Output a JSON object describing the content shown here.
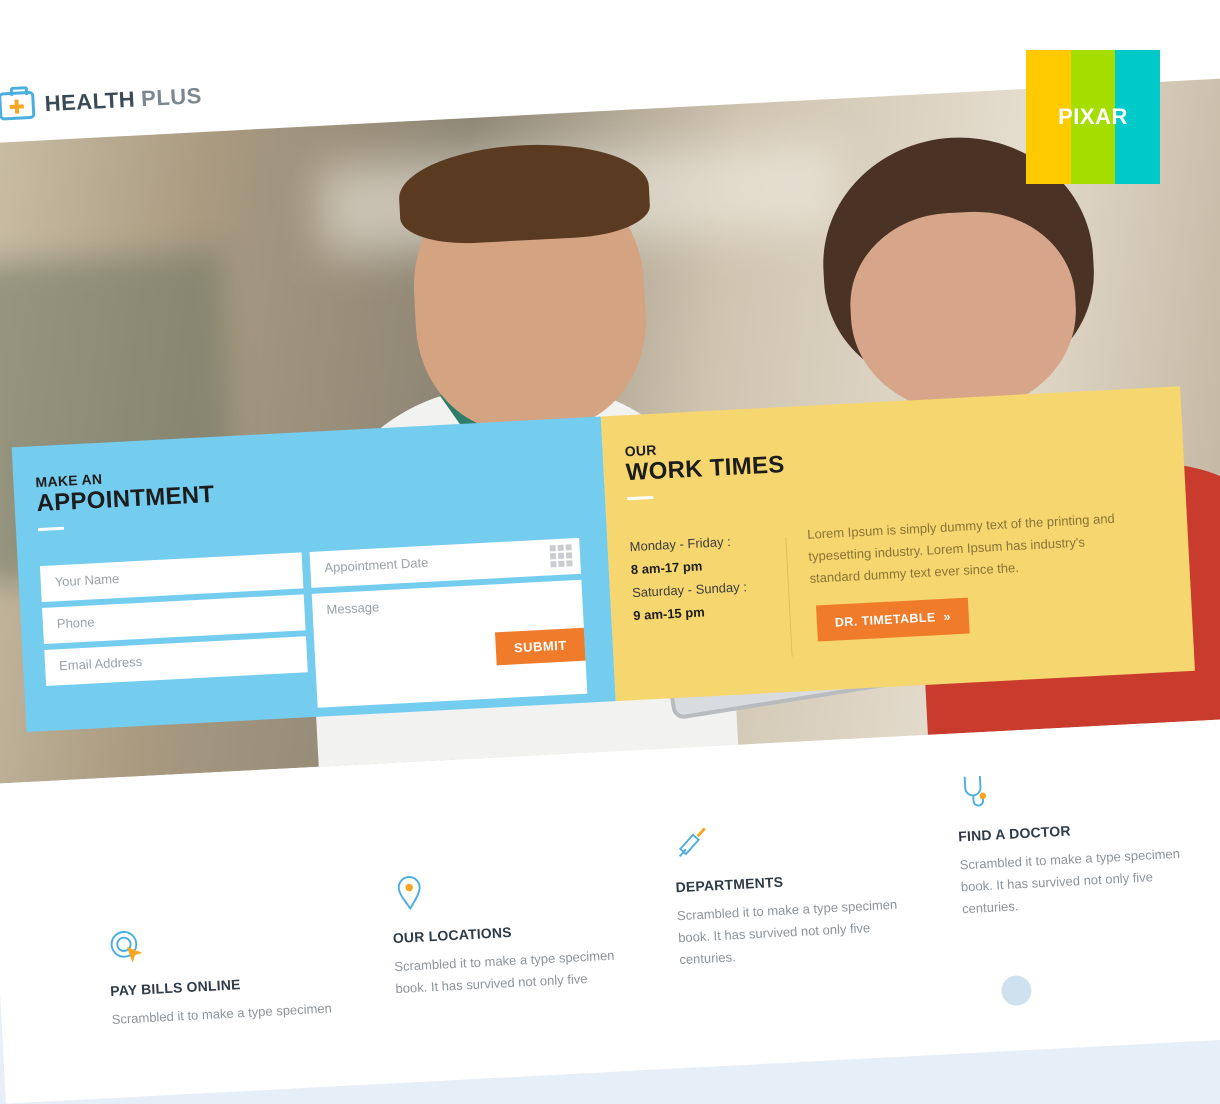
{
  "brand": {
    "name_part1": "HEALTH",
    "name_part2": "PLUS"
  },
  "badge": {
    "label": "PIXAR",
    "colors": [
      "#ffca00",
      "#a6dd00",
      "#00c9c9"
    ]
  },
  "appointment": {
    "pre_title": "MAKE AN",
    "title": "APPOINTMENT",
    "fields": {
      "name_placeholder": "Your Name",
      "phone_placeholder": "Phone",
      "email_placeholder": "Email Address",
      "date_placeholder": "Appointment Date",
      "message_placeholder": "Message"
    },
    "submit_label": "SUBMIT"
  },
  "worktimes": {
    "pre_title": "OUR",
    "title": "WORK TIMES",
    "weekday_label": "Monday - Friday :",
    "weekday_hours": "8 am-17 pm",
    "weekend_label": "Saturday - Sunday :",
    "weekend_hours": "9 am-15 pm",
    "description": "Lorem Ipsum is simply dummy text of the printing and typesetting industry. Lorem Ipsum has industry's standard dummy text ever since the.",
    "button_label": "DR. TIMETABLE",
    "button_icon": "»"
  },
  "services": [
    {
      "icon": "target-cursor-icon",
      "title": "PAY BILLS ONLINE",
      "text": "Scrambled it to make a type specimen"
    },
    {
      "icon": "location-pin-icon",
      "title": "OUR LOCATIONS",
      "text": "Scrambled it to make a type specimen book. It has survived not only five"
    },
    {
      "icon": "syringe-icon",
      "title": "DEPARTMENTS",
      "text": "Scrambled it to make a type specimen book. It has survived not only five centuries."
    },
    {
      "icon": "stethoscope-icon",
      "title": "FIND A DOCTOR",
      "text": "Scrambled it to make a type specimen book. It has survived not only five centuries."
    }
  ],
  "colors": {
    "accent_blue": "#74ccef",
    "accent_yellow": "#f6d66f",
    "button_orange": "#f07b2a"
  }
}
